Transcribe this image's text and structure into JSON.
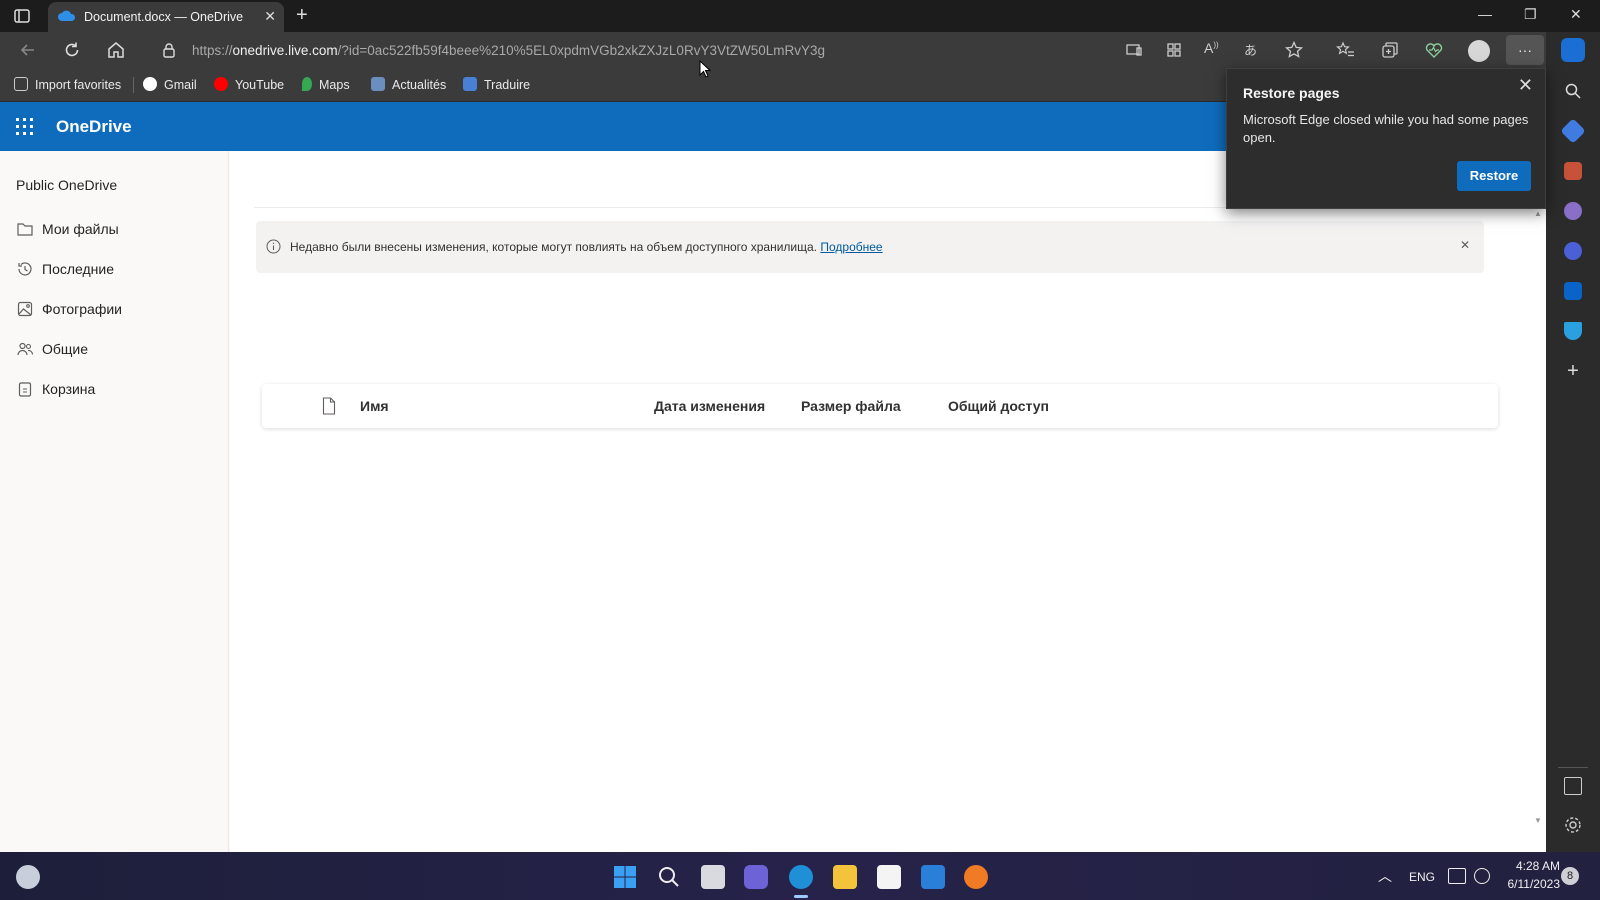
{
  "browser": {
    "tab_title": "Document.docx — OneDrive",
    "url_domain": "onedrive.live.com",
    "url_prefix": "https://",
    "url_rest": "/?id=0ac522fb59f4beee%210%5EL0xpdmVGb2xkZXJzL0RvY3VtZW50LmRvY3g",
    "favorites": [
      {
        "label": "Import favorites",
        "icon": "import-favorites-icon"
      },
      {
        "label": "Gmail",
        "icon": "google-icon"
      },
      {
        "label": "YouTube",
        "icon": "youtube-icon"
      },
      {
        "label": "Maps",
        "icon": "maps-pin-icon"
      },
      {
        "label": "Actualités",
        "icon": "news-icon"
      },
      {
        "label": "Traduire",
        "icon": "translate-icon"
      }
    ]
  },
  "restore_popup": {
    "title": "Restore pages",
    "message": "Microsoft Edge closed while you had some pages open.",
    "button": "Restore"
  },
  "onedrive": {
    "brand": "OneDrive",
    "nav_title": "Public OneDrive",
    "nav_items": [
      {
        "label": "Мои файлы",
        "icon": "folder-icon"
      },
      {
        "label": "Последние",
        "icon": "history-icon"
      },
      {
        "label": "Фотографии",
        "icon": "photo-icon"
      },
      {
        "label": "Общие",
        "icon": "people-icon"
      },
      {
        "label": "Корзина",
        "icon": "recycle-bin-icon"
      }
    ],
    "banner": {
      "message": "Недавно были внесены изменения, которые могут повлиять на объем доступного хранилища.",
      "link": "Подробнее"
    },
    "columns": [
      "Имя",
      "Дата изменения",
      "Размер файла",
      "Общий доступ"
    ]
  },
  "taskbar": {
    "language": "ENG",
    "time": "4:28 AM",
    "date": "6/11/2023",
    "notification_count": "8"
  },
  "colors": {
    "onedrive_blue": "#0f6cbd",
    "chrome_dark": "#3b3b3b",
    "popup_bg": "#2d2d2d"
  }
}
